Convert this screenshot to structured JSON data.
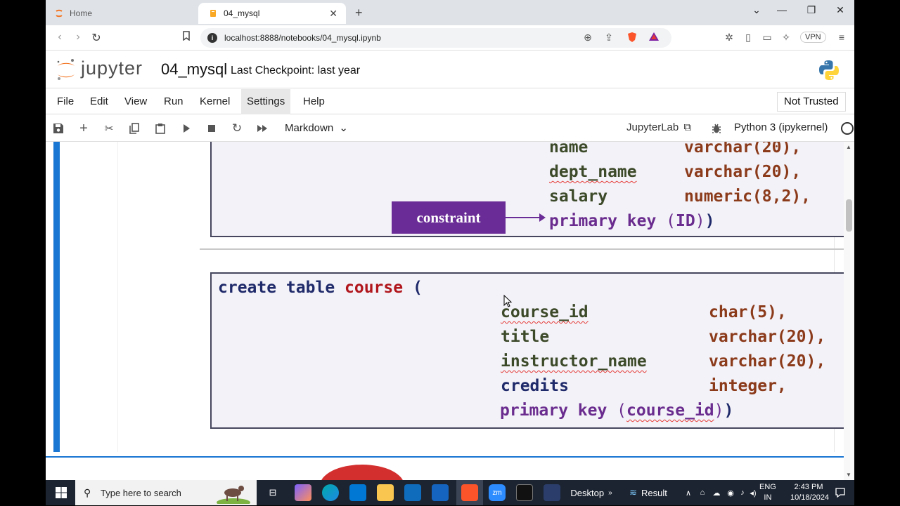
{
  "browser": {
    "tabs": [
      {
        "label": "Home",
        "active": false
      },
      {
        "label": "04_mysql",
        "active": true
      }
    ],
    "url": "localhost:8888/notebooks/04_mysql.ipynb",
    "vpn_label": "VPN"
  },
  "jupyter": {
    "brand": "jupyter",
    "notebook_name": "04_mysql",
    "checkpoint": "Last Checkpoint: last year",
    "menu": [
      "File",
      "Edit",
      "View",
      "Run",
      "Kernel",
      "Settings",
      "Help"
    ],
    "trust_status": "Not Trusted",
    "cell_type": "Markdown",
    "jupyterlab_link": "JupyterLab",
    "kernel_name": "Python 3 (ipykernel)"
  },
  "slide_top": {
    "rows": [
      {
        "col": "name",
        "type": "varchar(20),"
      },
      {
        "col": "dept_name",
        "type": "varchar(20),"
      },
      {
        "col": "salary",
        "type": "numeric(8,2),"
      }
    ],
    "constraint_label": "constraint",
    "pk_prefix": "primary key ",
    "pk_open": "(",
    "pk_col": "ID",
    "pk_close": ")",
    "pk_end": ")"
  },
  "slide_bottom": {
    "kw_create": "create table ",
    "table_name": "course",
    "open_paren": " (",
    "rows": [
      {
        "col": "course_id",
        "type": "char(5),"
      },
      {
        "col": "title",
        "type": "varchar(20),"
      },
      {
        "col": "instructor_name",
        "type": "varchar(20),"
      },
      {
        "col": "credits",
        "type": "integer,"
      }
    ],
    "pk_prefix": "primary key ",
    "pk_open": "(",
    "pk_col": "course_id",
    "pk_close": ")",
    "pk_end": ")"
  },
  "taskbar": {
    "search_placeholder": "Type here to search",
    "desktop_label": "Desktop",
    "result_label": "Result",
    "lang_line1": "ENG",
    "lang_line2": "IN",
    "time": "2:43 PM",
    "date": "10/18/2024"
  }
}
